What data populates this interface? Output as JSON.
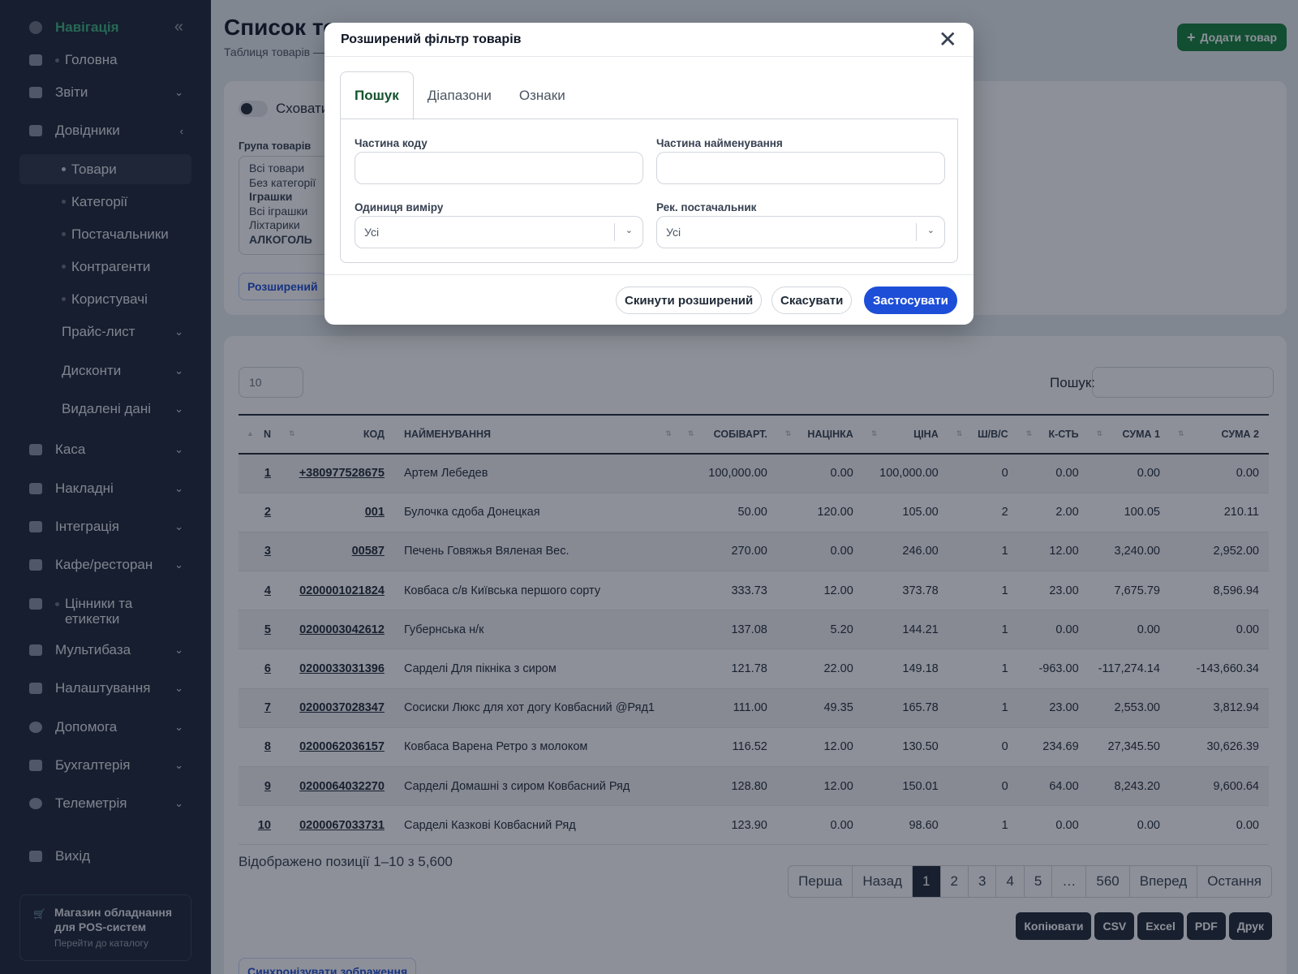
{
  "sidebar": {
    "title": "Навігація",
    "collapse_glyph": "«",
    "items": [
      {
        "label": "Головна",
        "icon": "home-icon"
      },
      {
        "label": "Звіти",
        "icon": "chart-icon"
      },
      {
        "label": "Довідники",
        "icon": "book-icon"
      },
      {
        "label": "Каса",
        "icon": "cash-register-icon"
      },
      {
        "label": "Накладні",
        "icon": "invoice-icon"
      },
      {
        "label": "Інтеграція",
        "icon": "tag-icon"
      },
      {
        "label": "Кафе/ресторан",
        "icon": "receipt-icon"
      },
      {
        "label": "Цінники та етикетки",
        "icon": "layers-icon"
      },
      {
        "label": "Мультибаза",
        "icon": "plug-icon"
      },
      {
        "label": "Налаштування",
        "icon": "sliders-icon"
      },
      {
        "label": "Допомога",
        "icon": "help-icon"
      },
      {
        "label": "Бухгалтерія",
        "icon": "calculator-icon"
      },
      {
        "label": "Телеметрія",
        "icon": "circle-icon"
      }
    ],
    "subitems": [
      "Товари",
      "Категорії",
      "Постачальники",
      "Контрагенти",
      "Користувачі"
    ],
    "subgroups": [
      "Прайс-лист",
      "Дисконти",
      "Видалені дані"
    ],
    "logout": "Вихід",
    "promo": {
      "title": "Магазин обладнання для POS-систем",
      "link": "Перейти до каталогу"
    }
  },
  "page": {
    "title": "Список товарів",
    "title_visible": "Список то",
    "subtitle": "Таблиця товарів —",
    "add_button": "Додати товар"
  },
  "filters": {
    "hide_toggle_label": "Сховати",
    "group_label": "Група товарів",
    "groups": [
      "Всі товари",
      "Без категорії",
      "Іграшки",
      "Всі іграшки",
      "Ліхтарики",
      "АЛКОГОЛЬ"
    ],
    "extended_button": "Розширений"
  },
  "table": {
    "length": "10",
    "search_label": "Пошук:",
    "columns": [
      "N",
      "КОД",
      "НАЙМЕНУВАННЯ",
      "СОБІВАРТ.",
      "НАЦІНКА",
      "ЦІНА",
      "Ш/В/С",
      "К-СТЬ",
      "СУМА 1",
      "СУМА 2"
    ],
    "rows": [
      [
        "1",
        "+380977528675",
        "Артем Лебедев",
        "100,000.00",
        "0.00",
        "100,000.00",
        "0",
        "0.00",
        "0.00",
        "0.00"
      ],
      [
        "2",
        "001",
        "Булочка сдоба Донецкая",
        "50.00",
        "120.00",
        "105.00",
        "2",
        "2.00",
        "100.05",
        "210.11"
      ],
      [
        "3",
        "00587",
        "Печень Говяжья Вяленая Вес.",
        "270.00",
        "0.00",
        "246.00",
        "1",
        "12.00",
        "3,240.00",
        "2,952.00"
      ],
      [
        "4",
        "0200001021824",
        "Ковбаса с/в Київська першого сорту",
        "333.73",
        "12.00",
        "373.78",
        "1",
        "23.00",
        "7,675.79",
        "8,596.94"
      ],
      [
        "5",
        "0200003042612",
        "Губернська н/к",
        "137.08",
        "5.20",
        "144.21",
        "1",
        "0.00",
        "0.00",
        "0.00"
      ],
      [
        "6",
        "0200033031396",
        "Сарделі Для пікніка з сиром",
        "121.78",
        "22.00",
        "149.18",
        "1",
        "-963.00",
        "-117,274.14",
        "-143,660.34"
      ],
      [
        "7",
        "0200037028347",
        "Сосиски Люкс для хот догу Ковбасний @Ряд1",
        "111.00",
        "49.35",
        "165.78",
        "1",
        "23.00",
        "2,553.00",
        "3,812.94"
      ],
      [
        "8",
        "0200062036157",
        "Ковбаса Варена Ретро з молоком",
        "116.52",
        "12.00",
        "130.50",
        "0",
        "234.69",
        "27,345.50",
        "30,626.39"
      ],
      [
        "9",
        "0200064032270",
        "Сарделі Домашні з сиром Ковбасний Ряд",
        "128.80",
        "12.00",
        "150.01",
        "0",
        "64.00",
        "8,243.20",
        "9,600.64"
      ],
      [
        "10",
        "0200067033731",
        "Сарделі Казкові Ковбасний Ряд",
        "123.90",
        "0.00",
        "98.60",
        "1",
        "0.00",
        "0.00",
        "0.00"
      ]
    ],
    "info": "Відображено позиції 1–10 з 5,600",
    "pager": [
      "Перша",
      "Назад",
      "1",
      "2",
      "3",
      "4",
      "5",
      "…",
      "560",
      "Вперед",
      "Остання"
    ],
    "pager_current": "1",
    "export": [
      "Копіювати",
      "CSV",
      "Excel",
      "PDF",
      "Друк"
    ],
    "sync_button": "Синхронізувати зображення"
  },
  "modal": {
    "title": "Розширений фільтр товарів",
    "tabs": [
      "Пошук",
      "Діапазони",
      "Ознаки"
    ],
    "active_tab": "Пошук",
    "fields": {
      "code_label": "Частина коду",
      "code_value": "",
      "name_label": "Частина найменування",
      "name_value": "",
      "unit_label": "Одиниця виміру",
      "unit_value": "Усі",
      "supplier_label": "Рек. постачальник",
      "supplier_value": "Усі"
    },
    "buttons": {
      "reset": "Скинути розширений",
      "cancel": "Скасувати",
      "apply": "Застосувати"
    }
  },
  "colors": {
    "sidebar_bg": "#1c2536",
    "nav_title": "#3fb37f",
    "primary": "#1d4ed8",
    "add_button": "#15803d",
    "active_tab": "#14532d"
  }
}
